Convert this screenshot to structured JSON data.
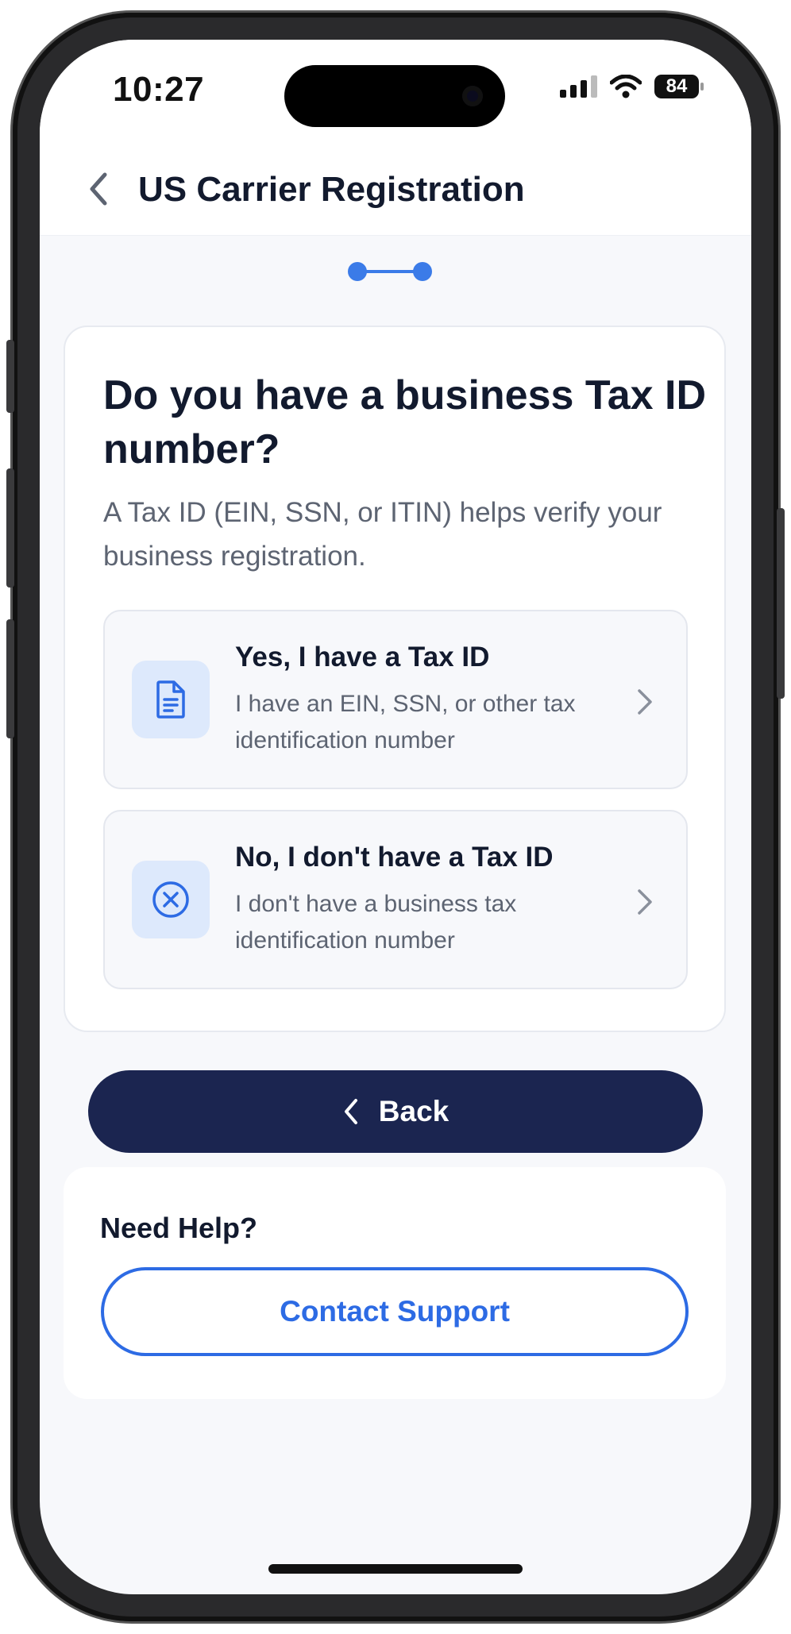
{
  "status_bar": {
    "time": "10:27",
    "battery": "84"
  },
  "header": {
    "title": "US Carrier Registration"
  },
  "question": {
    "title": "Do you have a business Tax ID number?",
    "subtitle": "A Tax ID (EIN, SSN, or ITIN) helps verify your business registration."
  },
  "options": [
    {
      "title": "Yes, I have a Tax ID",
      "description": "I have an EIN, SSN, or other tax identification number",
      "icon": "document-icon"
    },
    {
      "title": "No, I don't have a Tax ID",
      "description": "I don't have a business tax identification number",
      "icon": "x-circle-icon"
    }
  ],
  "back_button": {
    "label": "Back"
  },
  "help": {
    "title": "Need Help?",
    "contact_label": "Contact Support"
  },
  "colors": {
    "accent": "#2d6be4",
    "primary_dark": "#1b2550",
    "icon_bg": "#dde9fc",
    "stepper": "#3b7be8"
  }
}
